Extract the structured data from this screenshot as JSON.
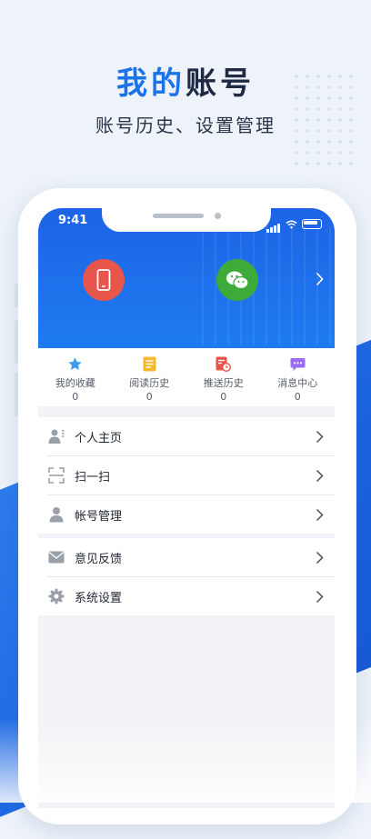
{
  "hero": {
    "title_highlight": "我的",
    "title_rest": "账号",
    "subtitle": "账号历史、设置管理"
  },
  "status_bar": {
    "time": "9:41"
  },
  "login_options": [
    {
      "icon": "mobile-phone-icon",
      "color": "#e8554a"
    },
    {
      "icon": "wechat-icon",
      "color": "#3daa3a"
    }
  ],
  "stats": [
    {
      "label": "我的收藏",
      "count": "0",
      "icon": "star-icon",
      "color": "#3b9cf0"
    },
    {
      "label": "阅读历史",
      "count": "0",
      "icon": "document-icon",
      "color": "#f5b730"
    },
    {
      "label": "推送历史",
      "count": "0",
      "icon": "push-history-icon",
      "color": "#e8554a"
    },
    {
      "label": "消息中心",
      "count": "0",
      "icon": "message-icon",
      "color": "#9b6cf0"
    }
  ],
  "menu_group_1": [
    {
      "label": "个人主页",
      "icon": "profile-card-icon"
    },
    {
      "label": "扫一扫",
      "icon": "scan-icon"
    },
    {
      "label": "帐号管理",
      "icon": "user-icon"
    }
  ],
  "menu_group_2": [
    {
      "label": "意见反馈",
      "icon": "mail-icon"
    },
    {
      "label": "系统设置",
      "icon": "gear-icon"
    }
  ],
  "colors": {
    "accent": "#1a73e8",
    "header_blue": "#1e6feb"
  }
}
